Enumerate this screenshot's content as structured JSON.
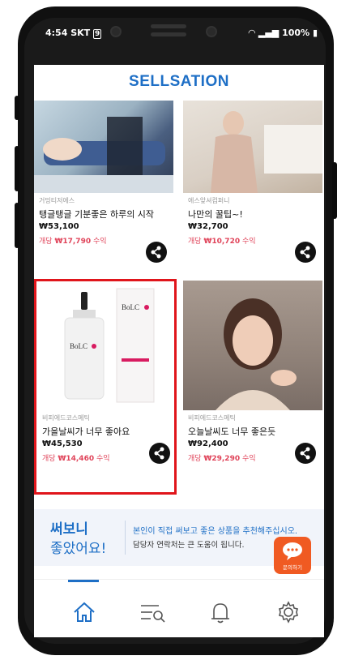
{
  "status_bar": {
    "time": "4:54",
    "carrier": "SKT",
    "sim": "9",
    "battery": "100%"
  },
  "app": {
    "logo": "SELLSATION"
  },
  "products": [
    {
      "seller": "거밍티저에스",
      "title": "탱글탱글 기분좋은 하루의 시작",
      "price": "₩53,100",
      "earn_prefix": "개당",
      "earn_value": "₩17,790",
      "earn_suffix": "수익",
      "share_icon": "share-icon"
    },
    {
      "seller": "에스앞셔컴퍼니",
      "title": "나만의 꿀팁~!",
      "price": "₩32,700",
      "earn_prefix": "개당",
      "earn_value": "₩10,720",
      "earn_suffix": "수익",
      "share_icon": "share-icon"
    },
    {
      "seller": "비피에드코스메틱",
      "title": "가을날씨가 너무 좋아요",
      "price": "₩45,530",
      "earn_prefix": "개당",
      "earn_value": "₩14,460",
      "earn_suffix": "수익",
      "share_icon": "share-icon",
      "product_label": "BoLC"
    },
    {
      "seller": "비피에드코스메틱",
      "title": "오늘날씨도 너무 좋은듯",
      "price": "₩92,400",
      "earn_prefix": "개당",
      "earn_value": "₩29,290",
      "earn_suffix": "수익",
      "share_icon": "share-icon"
    }
  ],
  "banner": {
    "title1": "써보니",
    "title2": "좋았어요!",
    "line1": "본인이 직접 써보고 좋은 상품을 추천해주십시오.",
    "line2": "담당자 연락처는 큰 도움이 됩니다.",
    "chat_label": "문의하기"
  },
  "tabs": [
    {
      "icon": "home-icon",
      "active": true
    },
    {
      "icon": "search-list-icon",
      "active": false
    },
    {
      "icon": "bell-icon",
      "active": false
    },
    {
      "icon": "settings-gear-icon",
      "active": false
    }
  ],
  "colors": {
    "brand": "#1e6fc6",
    "earn": "#e0445a",
    "highlight": "#e0151b",
    "chat": "#f05a22"
  }
}
